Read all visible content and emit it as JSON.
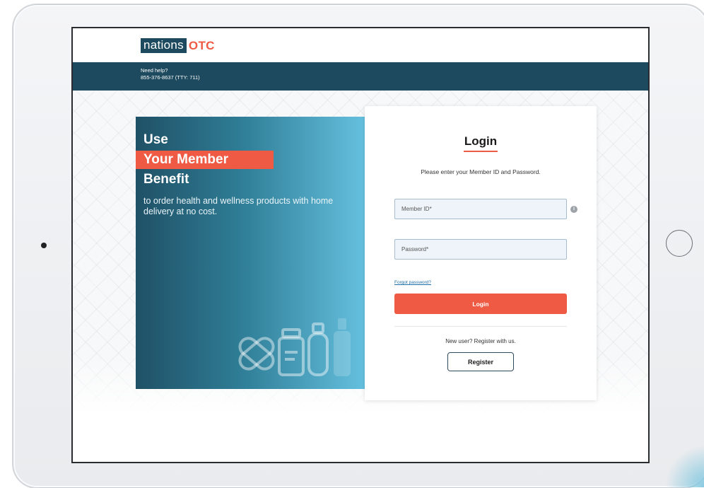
{
  "brand": {
    "name_part1": "nations",
    "name_part2": "OTC",
    "navy": "#1d4a5e",
    "coral": "#ef5a44"
  },
  "help": {
    "line1": "Need help?",
    "line2": "855-376-8637 (TTY: 711)"
  },
  "promo": {
    "line1": "Use",
    "line2": "Your Member",
    "line3": "Benefit",
    "subtitle": "to order health and wellness products with home delivery at no cost.",
    "art_icons": [
      "bandage-icon",
      "pill-bottle-icon",
      "lotion-bottle-icon"
    ]
  },
  "login": {
    "title": "Login",
    "instructions": "Please enter your Member ID and Password.",
    "member_id_placeholder": "Member ID*",
    "member_id_value": "",
    "password_placeholder": "Password*",
    "password_value": "",
    "info_icon": "info-icon",
    "forgot_link": "Forgot password?",
    "submit_label": "Login",
    "new_user_text": "New user? Register with us.",
    "register_label": "Register"
  }
}
